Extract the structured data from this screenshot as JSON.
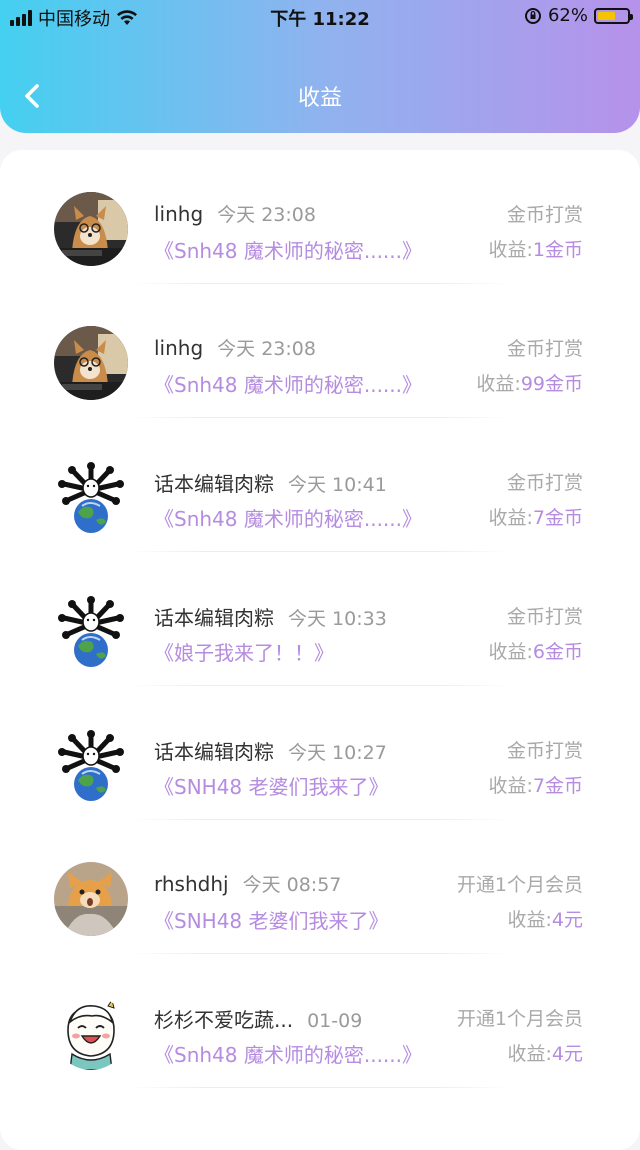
{
  "status_bar": {
    "carrier": "中国移动",
    "time": "下午 11:22",
    "battery_percent": "62%",
    "battery_level": 0.62
  },
  "header": {
    "title": "收益",
    "back_icon": "chevron-left-icon"
  },
  "colors": {
    "gradient_start": "#44d0f0",
    "gradient_end": "#b692ea",
    "accent_purple": "#b58ce0",
    "muted_gray": "#a9a9a9"
  },
  "income_list": [
    {
      "user": "linhg",
      "time": "今天 23:08",
      "work": "《Snh48 魔术师的秘密......》",
      "type": "金币打赏",
      "income_label": "收益:",
      "income_value": "1金币",
      "avatar": "shiba-dog-avatar"
    },
    {
      "user": "linhg",
      "time": "今天 23:08",
      "work": "《Snh48 魔术师的秘密......》",
      "type": "金币打赏",
      "income_label": "收益:",
      "income_value": "99金币",
      "avatar": "shiba-dog-avatar"
    },
    {
      "user": "话本编辑肉粽",
      "time": "今天 10:41",
      "work": "《Snh48 魔术师的秘密......》",
      "type": "金币打赏",
      "income_label": "收益:",
      "income_value": "7金币",
      "avatar": "earth-cartoon-avatar"
    },
    {
      "user": "话本编辑肉粽",
      "time": "今天 10:33",
      "work": "《娘子我来了！！》",
      "type": "金币打赏",
      "income_label": "收益:",
      "income_value": "6金币",
      "avatar": "earth-cartoon-avatar"
    },
    {
      "user": "话本编辑肉粽",
      "time": "今天 10:27",
      "work": "《SNH48 老婆们我来了》",
      "type": "金币打赏",
      "income_label": "收益:",
      "income_value": "7金币",
      "avatar": "earth-cartoon-avatar"
    },
    {
      "user": "rhshdhj",
      "time": "今天 08:57",
      "work": "《SNH48 老婆们我来了》",
      "type": "开通1个月会员",
      "income_label": "收益:",
      "income_value": "4元",
      "avatar": "orange-cat-avatar"
    },
    {
      "user": "杉杉不爱吃蔬...",
      "time": "01-09",
      "work": "《Snh48 魔术师的秘密......》",
      "type": "开通1个月会员",
      "income_label": "收益:",
      "income_value": "4元",
      "avatar": "cartoon-kid-avatar"
    }
  ]
}
